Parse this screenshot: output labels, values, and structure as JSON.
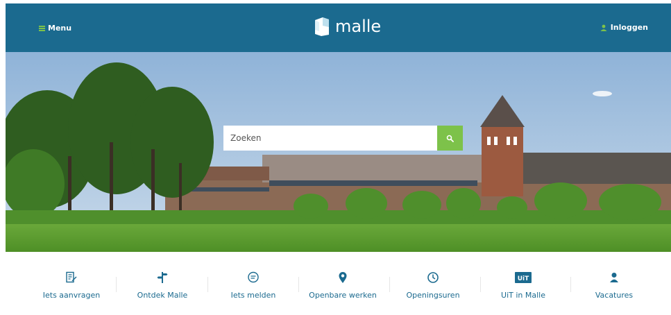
{
  "header": {
    "menu_label": "Menu",
    "logo_text": "malle",
    "login_label": "Inloggen",
    "bg_color": "#1b6a8f",
    "accent_color": "#7dc24a"
  },
  "hero": {
    "search": {
      "placeholder": "Zoeken",
      "button_icon": "search-icon"
    }
  },
  "quick_links": [
    {
      "label": "Iets aanvragen",
      "icon": "form-edit-icon"
    },
    {
      "label": "Ontdek Malle",
      "icon": "signpost-icon"
    },
    {
      "label": "Iets melden",
      "icon": "chat-bubble-icon"
    },
    {
      "label": "Openbare werken",
      "icon": "map-pin-icon"
    },
    {
      "label": "Openingsuren",
      "icon": "clock-icon"
    },
    {
      "label": "UiT in Malle",
      "icon": "uit-logo-icon"
    },
    {
      "label": "Vacatures",
      "icon": "person-icon"
    }
  ]
}
